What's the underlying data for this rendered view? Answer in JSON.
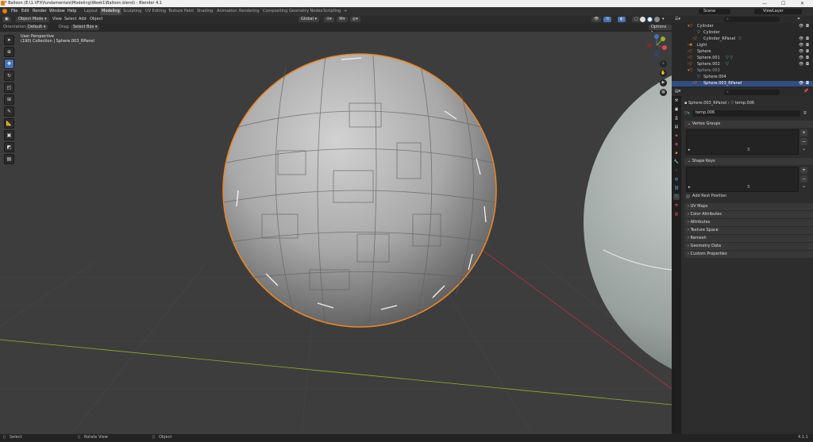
{
  "window": {
    "title": "* Balloon (E:\\1.VFX\\fundamentals\\Modeling\\Week1\\Balloon.blend) - Blender 4.1",
    "controls": [
      "—",
      "☐",
      "✕"
    ]
  },
  "menus": [
    "File",
    "Edit",
    "Render",
    "Window",
    "Help"
  ],
  "workspaces": [
    "Layout",
    "Modeling",
    "Sculpting",
    "UV Editing",
    "Texture Paint",
    "Shading",
    "Animation",
    "Rendering",
    "Compositing",
    "Geometry Nodes",
    "Scripting"
  ],
  "active_workspace": "Modeling",
  "scene": {
    "label": "Scene",
    "view_layer": "ViewLayer"
  },
  "viewport_header": {
    "mode": "Object Mode",
    "menus": [
      "View",
      "Select",
      "Add",
      "Object"
    ],
    "transform_orientation": "Global",
    "options_label": "Options"
  },
  "tool_settings": {
    "orientation_label": "Orientation:",
    "orientation_value": "Default",
    "drag_label": "Drag:",
    "drag_value": "Select Box"
  },
  "viewport_overlay": {
    "perspective": "User Perspective",
    "collection_info": "(190) Collection | Sphere.003_RPanel"
  },
  "outliner": {
    "search_placeholder": "",
    "rows": [
      {
        "name": "Cylinder",
        "indent": 1
      },
      {
        "name": "Cylinder",
        "indent": 2
      },
      {
        "name": "Cylinder_RPanel",
        "indent": 2
      },
      {
        "name": "Light",
        "indent": 1
      },
      {
        "name": "Sphere",
        "indent": 1
      },
      {
        "name": "Sphere.001",
        "indent": 1
      },
      {
        "name": "Sphere.002",
        "indent": 1
      },
      {
        "name": "Sphere.003",
        "indent": 1
      },
      {
        "name": "Sphere.004",
        "indent": 2
      },
      {
        "name": "Sphere.003_RPanel",
        "indent": 2
      }
    ],
    "selected_row": "Sphere.003_RPanel"
  },
  "properties": {
    "breadcrumb_object": "Sphere.003_RPanel",
    "breadcrumb_data": "temp.006",
    "data_name": "temp.006",
    "panels": {
      "vertex_groups": "Vertex Groups",
      "shape_keys": "Shape Keys",
      "add_rest_position": "Add Rest Position",
      "uv_maps": "UV Maps",
      "color_attributes": "Color Attributes",
      "attributes": "Attributes",
      "texture_space": "Texture Space",
      "remesh": "Remesh",
      "geometry_data": "Geometry Data",
      "custom_properties": "Custom Properties"
    }
  },
  "status_bar": {
    "select": "Select",
    "rotate_view": "Rotate View",
    "object": "Object",
    "version": "4.1.1"
  },
  "colors": {
    "accent": "#4772b3",
    "selection_outline": "#e8872a",
    "x_axis": "#b5343f",
    "y_axis": "#8bb42a"
  }
}
